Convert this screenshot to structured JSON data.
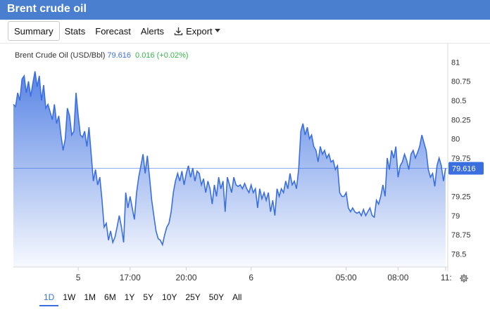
{
  "header": {
    "title": "Brent crude oil"
  },
  "tabs": [
    {
      "label": "Summary",
      "active": true
    },
    {
      "label": "Stats"
    },
    {
      "label": "Forecast"
    },
    {
      "label": "Alerts"
    },
    {
      "label": "Export",
      "icon": "download-icon",
      "dropdown": true
    }
  ],
  "legend": {
    "series": "Brent Crude Oil (USD/Bbl)",
    "last": "79.616",
    "change": "0.016 (+0.02%)"
  },
  "ranges": [
    "1D",
    "1W",
    "1M",
    "6M",
    "1Y",
    "5Y",
    "10Y",
    "25Y",
    "50Y",
    "All"
  ],
  "active_range": "1D",
  "colors": {
    "header_bg": "#4a7fd0",
    "line": "#3b6fe0",
    "change_positive": "#35b44a"
  },
  "chart_data": {
    "type": "area",
    "series_name": "Brent Crude Oil (USD/Bbl)",
    "ylim": [
      78.33,
      81.15
    ],
    "yticks": [
      81,
      80.75,
      80.5,
      80.25,
      80,
      79.75,
      79.25,
      79,
      78.75,
      78.5
    ],
    "xlabels": [
      {
        "label": "5",
        "t": 15
      },
      {
        "label": "17:00",
        "t": 27
      },
      {
        "label": "20:00",
        "t": 40
      },
      {
        "label": "6",
        "t": 55
      },
      {
        "label": "05:00",
        "t": 77
      },
      {
        "label": "08:00",
        "t": 89
      },
      {
        "label": "11:",
        "t": 100
      }
    ],
    "current_value": 79.616,
    "current_label": "79.616",
    "t_range": [
      0,
      100.5
    ],
    "points": [
      [
        0,
        80.45
      ],
      [
        0.5,
        80.42
      ],
      [
        1,
        80.6
      ],
      [
        1.5,
        80.5
      ],
      [
        2,
        80.78
      ],
      [
        2.5,
        80.82
      ],
      [
        3,
        80.6
      ],
      [
        3.5,
        80.75
      ],
      [
        4,
        80.55
      ],
      [
        4.5,
        80.72
      ],
      [
        5,
        80.88
      ],
      [
        5.5,
        80.68
      ],
      [
        6,
        80.82
      ],
      [
        6.5,
        80.5
      ],
      [
        7,
        80.7
      ],
      [
        7.5,
        80.4
      ],
      [
        8,
        80.45
      ],
      [
        8.5,
        80.35
      ],
      [
        9,
        80.25
      ],
      [
        9.5,
        80.45
      ],
      [
        10,
        80.2
      ],
      [
        10.5,
        80.3
      ],
      [
        11,
        80.05
      ],
      [
        11.5,
        79.85
      ],
      [
        12,
        80.0
      ],
      [
        12.5,
        80.4
      ],
      [
        13,
        80.3
      ],
      [
        13.5,
        80.05
      ],
      [
        14,
        80.1
      ],
      [
        14.5,
        80.6
      ],
      [
        15,
        80.3
      ],
      [
        15.5,
        80.05
      ],
      [
        16,
        80.02
      ],
      [
        16.5,
        80.1
      ],
      [
        17,
        79.9
      ],
      [
        17.5,
        80.15
      ],
      [
        18,
        79.8
      ],
      [
        18.5,
        79.45
      ],
      [
        19,
        79.6
      ],
      [
        19.5,
        79.4
      ],
      [
        20,
        79.5
      ],
      [
        20.5,
        79.2
      ],
      [
        21,
        78.85
      ],
      [
        21.5,
        78.9
      ],
      [
        22,
        78.68
      ],
      [
        22.5,
        78.8
      ],
      [
        23,
        78.65
      ],
      [
        23.5,
        78.72
      ],
      [
        24,
        78.85
      ],
      [
        24.5,
        79.0
      ],
      [
        25,
        78.85
      ],
      [
        25.5,
        78.65
      ],
      [
        26,
        79.3
      ],
      [
        26.5,
        79.1
      ],
      [
        27,
        79.25
      ],
      [
        27.5,
        79.1
      ],
      [
        28,
        78.95
      ],
      [
        28.5,
        79.3
      ],
      [
        29,
        79.5
      ],
      [
        29.5,
        79.65
      ],
      [
        30,
        79.8
      ],
      [
        30.5,
        79.55
      ],
      [
        31,
        79.78
      ],
      [
        31.5,
        79.5
      ],
      [
        32,
        79.2
      ],
      [
        32.5,
        79.0
      ],
      [
        33,
        78.8
      ],
      [
        33.5,
        78.7
      ],
      [
        34,
        78.68
      ],
      [
        34.5,
        78.62
      ],
      [
        35,
        78.75
      ],
      [
        35.5,
        78.85
      ],
      [
        36,
        78.9
      ],
      [
        36.5,
        79.05
      ],
      [
        37,
        79.3
      ],
      [
        37.5,
        79.45
      ],
      [
        38,
        79.55
      ],
      [
        38.5,
        79.45
      ],
      [
        39,
        79.58
      ],
      [
        39.5,
        79.4
      ],
      [
        40,
        79.55
      ],
      [
        40.5,
        79.65
      ],
      [
        41,
        79.5
      ],
      [
        41.5,
        79.62
      ],
      [
        42,
        79.45
      ],
      [
        42.5,
        79.58
      ],
      [
        43,
        79.55
      ],
      [
        43.5,
        79.4
      ],
      [
        44,
        79.48
      ],
      [
        44.5,
        79.3
      ],
      [
        45,
        79.45
      ],
      [
        45.5,
        79.35
      ],
      [
        46,
        79.15
      ],
      [
        46.5,
        79.4
      ],
      [
        47,
        79.25
      ],
      [
        47.5,
        79.5
      ],
      [
        48,
        79.35
      ],
      [
        48.5,
        79.45
      ],
      [
        49,
        79.05
      ],
      [
        49.5,
        79.5
      ],
      [
        50,
        79.4
      ],
      [
        50.5,
        79.3
      ],
      [
        51,
        79.5
      ],
      [
        51.5,
        79.4
      ],
      [
        52,
        79.38
      ],
      [
        52.5,
        79.4
      ],
      [
        53,
        79.35
      ],
      [
        53.5,
        79.42
      ],
      [
        54,
        79.35
      ],
      [
        54.5,
        79.3
      ],
      [
        55,
        79.4
      ],
      [
        55.5,
        79.3
      ],
      [
        56,
        79.35
      ],
      [
        56.5,
        79.1
      ],
      [
        57,
        79.35
      ],
      [
        57.5,
        79.22
      ],
      [
        58,
        79.3
      ],
      [
        58.5,
        79.2
      ],
      [
        59,
        79.3
      ],
      [
        59.5,
        79.05
      ],
      [
        60,
        79.2
      ],
      [
        60.5,
        79.0
      ],
      [
        61,
        79.35
      ],
      [
        61.5,
        79.25
      ],
      [
        62,
        79.35
      ],
      [
        62.5,
        79.3
      ],
      [
        63,
        79.45
      ],
      [
        63.5,
        79.35
      ],
      [
        64,
        79.55
      ],
      [
        64.5,
        79.4
      ],
      [
        65,
        79.45
      ],
      [
        65.5,
        79.35
      ],
      [
        66,
        79.6
      ],
      [
        66.5,
        80.1
      ],
      [
        67,
        80.2
      ],
      [
        67.5,
        80.05
      ],
      [
        68,
        80.15
      ],
      [
        68.5,
        80.0
      ],
      [
        69,
        80.05
      ],
      [
        69.5,
        79.9
      ],
      [
        70,
        79.85
      ],
      [
        70.5,
        79.7
      ],
      [
        71,
        79.9
      ],
      [
        71.5,
        79.8
      ],
      [
        72,
        79.85
      ],
      [
        72.5,
        79.75
      ],
      [
        73,
        79.8
      ],
      [
        73.5,
        79.7
      ],
      [
        74,
        79.72
      ],
      [
        74.5,
        79.6
      ],
      [
        75,
        79.65
      ],
      [
        75.5,
        79.3
      ],
      [
        76,
        79.25
      ],
      [
        76.5,
        79.25
      ],
      [
        77,
        79.3
      ],
      [
        77.5,
        79.1
      ],
      [
        78,
        79.05
      ],
      [
        78.5,
        79.1
      ],
      [
        79,
        79.05
      ],
      [
        79.5,
        79.03
      ],
      [
        80,
        79.05
      ],
      [
        80.5,
        79.0
      ],
      [
        81,
        79.08
      ],
      [
        81.5,
        79.0
      ],
      [
        82,
        79.05
      ],
      [
        82.5,
        79.1
      ],
      [
        83,
        79.0
      ],
      [
        83.5,
        78.98
      ],
      [
        84,
        79.2
      ],
      [
        84.5,
        79.15
      ],
      [
        85,
        79.25
      ],
      [
        85.5,
        79.4
      ],
      [
        86,
        79.25
      ],
      [
        86.5,
        79.75
      ],
      [
        87,
        79.6
      ],
      [
        87.5,
        79.85
      ],
      [
        88,
        79.75
      ],
      [
        88.5,
        79.9
      ],
      [
        89,
        79.5
      ],
      [
        89.5,
        79.65
      ],
      [
        90,
        79.7
      ],
      [
        90.5,
        79.8
      ],
      [
        91,
        79.72
      ],
      [
        91.5,
        79.6
      ],
      [
        92,
        79.8
      ],
      [
        92.5,
        79.85
      ],
      [
        93,
        79.75
      ],
      [
        93.5,
        79.82
      ],
      [
        94,
        79.9
      ],
      [
        94.5,
        80.05
      ],
      [
        95,
        79.95
      ],
      [
        95.5,
        79.85
      ],
      [
        96,
        79.6
      ],
      [
        96.5,
        79.5
      ],
      [
        97,
        79.55
      ],
      [
        97.5,
        79.38
      ],
      [
        98,
        79.65
      ],
      [
        98.5,
        79.75
      ],
      [
        99,
        79.65
      ],
      [
        99.5,
        79.45
      ],
      [
        100,
        79.616
      ]
    ]
  }
}
